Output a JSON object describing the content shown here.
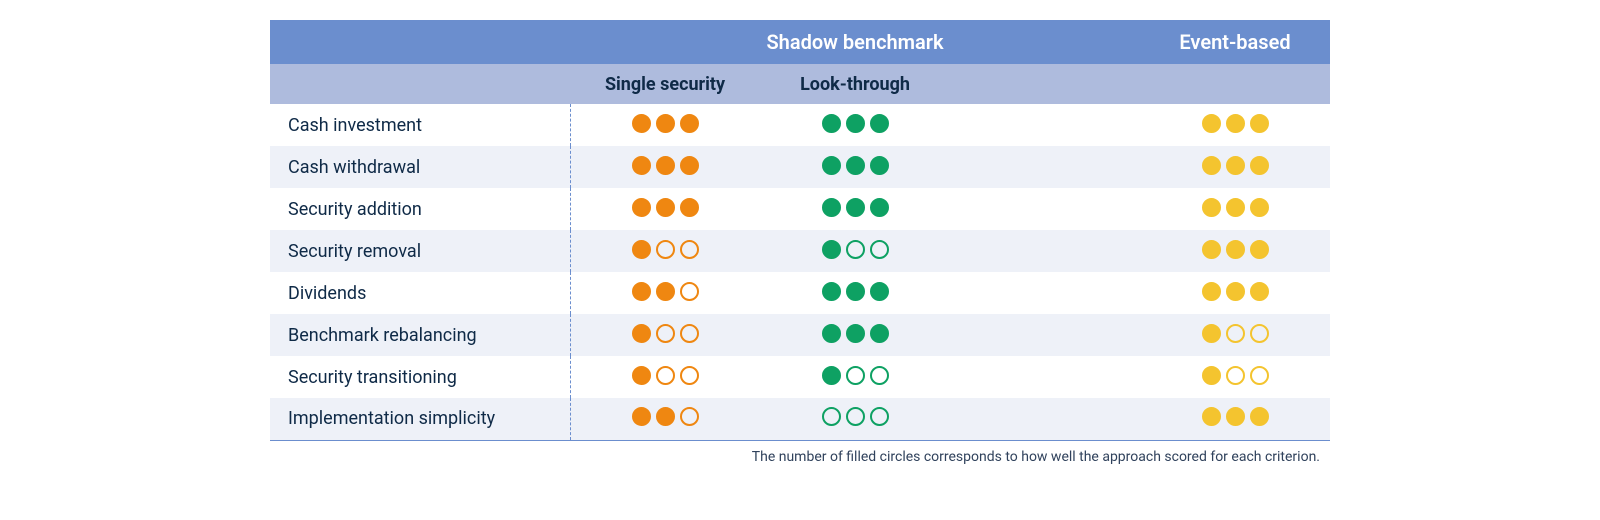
{
  "header": {
    "shadow_label": "Shadow benchmark",
    "event_label": "Event-based",
    "sub_single": "Single security",
    "sub_look": "Look-through"
  },
  "columns": [
    {
      "key": "single_security",
      "color": "orange"
    },
    {
      "key": "look_through",
      "color": "green"
    },
    {
      "key": "event_based",
      "color": "yellow"
    }
  ],
  "rows": [
    {
      "label": "Cash investment",
      "scores": {
        "single_security": 3,
        "look_through": 3,
        "event_based": 3
      }
    },
    {
      "label": "Cash withdrawal",
      "scores": {
        "single_security": 3,
        "look_through": 3,
        "event_based": 3
      }
    },
    {
      "label": "Security addition",
      "scores": {
        "single_security": 3,
        "look_through": 3,
        "event_based": 3
      }
    },
    {
      "label": "Security removal",
      "scores": {
        "single_security": 1,
        "look_through": 1,
        "event_based": 3
      }
    },
    {
      "label": "Dividends",
      "scores": {
        "single_security": 2,
        "look_through": 3,
        "event_based": 3
      }
    },
    {
      "label": "Benchmark rebalancing",
      "scores": {
        "single_security": 1,
        "look_through": 3,
        "event_based": 1
      }
    },
    {
      "label": "Security transitioning",
      "scores": {
        "single_security": 1,
        "look_through": 1,
        "event_based": 1
      }
    },
    {
      "label": "Implementation simplicity",
      "scores": {
        "single_security": 2,
        "look_through": 0,
        "event_based": 3
      }
    }
  ],
  "footnote": "The number of filled circles corresponds to how well the approach scored for each criterion.",
  "colors": {
    "orange": "#ef8711",
    "green": "#0ea163",
    "yellow": "#f4c42f"
  },
  "chart_data": {
    "type": "table",
    "title": "",
    "scale": {
      "min": 0,
      "max": 3,
      "unit": "filled circles"
    },
    "categories": [
      "Cash investment",
      "Cash withdrawal",
      "Security addition",
      "Security removal",
      "Dividends",
      "Benchmark rebalancing",
      "Security transitioning",
      "Implementation simplicity"
    ],
    "series": [
      {
        "name": "Shadow benchmark – Single security",
        "values": [
          3,
          3,
          3,
          1,
          2,
          1,
          1,
          2
        ]
      },
      {
        "name": "Shadow benchmark – Look-through",
        "values": [
          3,
          3,
          3,
          1,
          3,
          3,
          1,
          0
        ]
      },
      {
        "name": "Event-based",
        "values": [
          3,
          3,
          3,
          3,
          3,
          1,
          1,
          3
        ]
      }
    ],
    "footnote": "The number of filled circles corresponds to how well the approach scored for each criterion."
  }
}
